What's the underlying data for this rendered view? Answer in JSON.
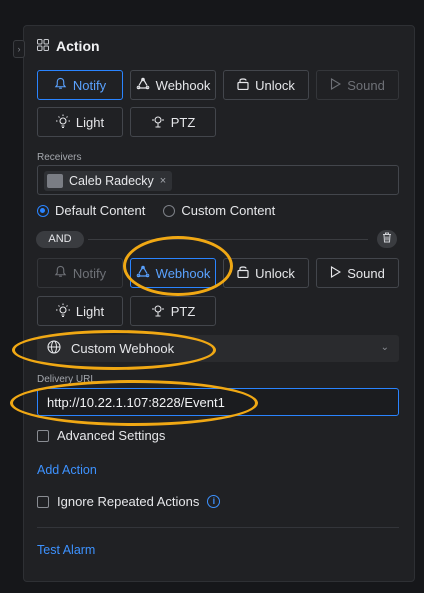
{
  "panel": {
    "collapse_glyph": "›",
    "section_title": "Action",
    "section_icon": "apps-icon"
  },
  "action_group_1": {
    "buttons": [
      {
        "label": "Notify",
        "icon": "bell-icon",
        "state": "active"
      },
      {
        "label": "Webhook",
        "icon": "webhook-icon",
        "state": "normal"
      },
      {
        "label": "Unlock",
        "icon": "unlock-icon",
        "state": "normal"
      },
      {
        "label": "Sound",
        "icon": "play-icon",
        "state": "disabled"
      },
      {
        "label": "Light",
        "icon": "lightbulb-icon",
        "state": "normal"
      },
      {
        "label": "PTZ",
        "icon": "ptz-icon",
        "state": "normal"
      }
    ],
    "receivers_label": "Receivers",
    "receiver_chip": "Caleb Radecky",
    "receiver_remove": "×",
    "content_options": [
      {
        "label": "Default Content",
        "selected": true
      },
      {
        "label": "Custom Content",
        "selected": false
      }
    ]
  },
  "and_badge": "AND",
  "action_group_2": {
    "buttons": [
      {
        "label": "Notify",
        "icon": "bell-icon",
        "state": "disabled"
      },
      {
        "label": "Webhook",
        "icon": "webhook-icon",
        "state": "active"
      },
      {
        "label": "Unlock",
        "icon": "unlock-icon",
        "state": "normal"
      },
      {
        "label": "Sound",
        "icon": "play-icon",
        "state": "disabled"
      },
      {
        "label": "Light",
        "icon": "lightbulb-icon",
        "state": "normal"
      },
      {
        "label": "PTZ",
        "icon": "ptz-icon",
        "state": "normal"
      }
    ],
    "webhook_type": "Custom Webhook",
    "delivery_url_label": "Delivery URL",
    "delivery_url_value": "http://10.22.1.107:8228/Event1",
    "advanced_settings": "Advanced Settings"
  },
  "add_action": "Add Action",
  "ignore_repeated": "Ignore Repeated Actions",
  "info_glyph": "i",
  "test_alarm": "Test Alarm",
  "colors": {
    "accent": "#2a84ff",
    "annotation": "#f0a814",
    "background": "#202124"
  }
}
